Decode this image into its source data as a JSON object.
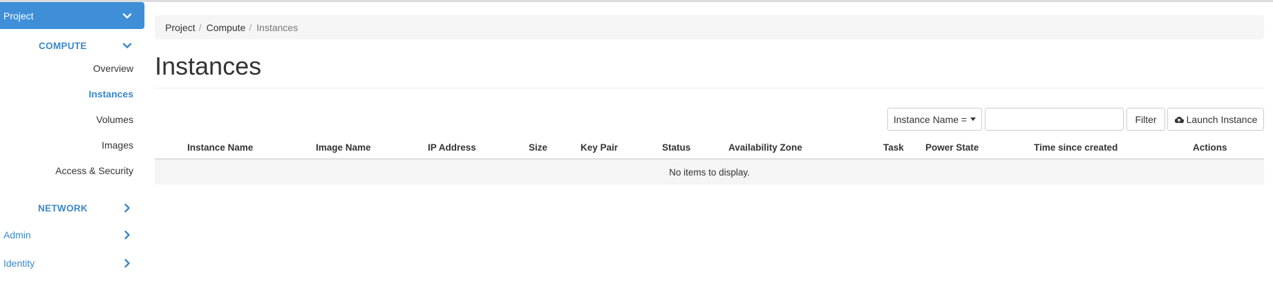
{
  "sidebar": {
    "project_label": "Project",
    "compute_label": "COMPUTE",
    "items": [
      {
        "label": "Overview"
      },
      {
        "label": "Instances"
      },
      {
        "label": "Volumes"
      },
      {
        "label": "Images"
      },
      {
        "label": "Access & Security"
      }
    ],
    "network_label": "NETWORK",
    "admin_label": "Admin",
    "identity_label": "Identity"
  },
  "breadcrumb": [
    "Project",
    "Compute",
    "Instances"
  ],
  "page": {
    "title": "Instances"
  },
  "toolbar": {
    "filter_select_label": "Instance Name =",
    "filter_input_value": "",
    "filter_button_label": "Filter",
    "launch_button_label": "Launch Instance"
  },
  "table": {
    "columns": [
      "Instance Name",
      "Image Name",
      "IP Address",
      "Size",
      "Key Pair",
      "Status",
      "Availability Zone",
      "Task",
      "Power State",
      "Time since created",
      "Actions"
    ],
    "empty_message": "No items to display."
  },
  "colors": {
    "accent": "#3e8fd8",
    "link": "#3a87c8",
    "breadcrumb_bg": "#f5f5f5"
  },
  "icons": {
    "project_chevron": "chevron-down-icon",
    "compute_chevron": "chevron-down-icon",
    "network_chevron": "chevron-right-icon",
    "admin_chevron": "chevron-right-icon",
    "identity_chevron": "chevron-right-icon",
    "launch": "cloud-upload-icon"
  }
}
